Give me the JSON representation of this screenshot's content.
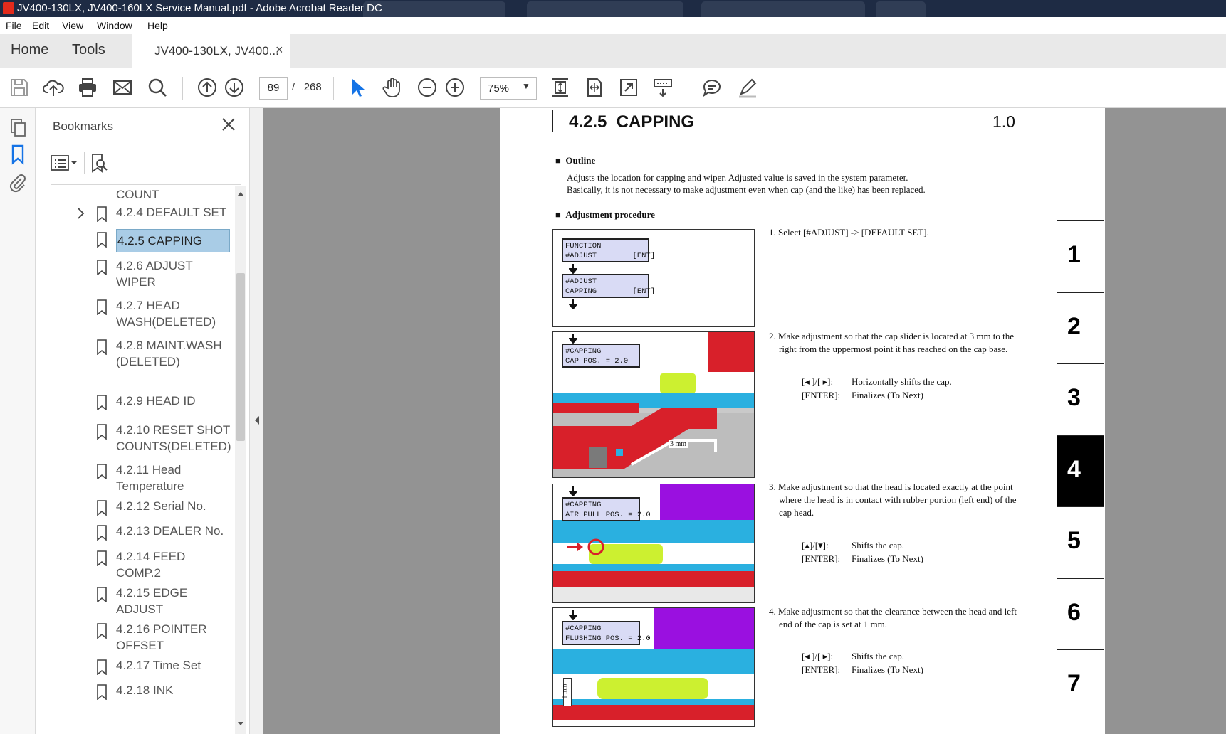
{
  "window": {
    "title": "JV400-130LX, JV400-160LX Service Manual.pdf - Adobe Acrobat Reader DC"
  },
  "menu": [
    "File",
    "Edit",
    "View",
    "Window",
    "Help"
  ],
  "tabs": {
    "home": "Home",
    "tools": "Tools",
    "document": "JV400-130LX, JV400...",
    "close": "×"
  },
  "toolbar": {
    "page_current": "89",
    "page_sep": "/",
    "page_total": "268",
    "zoom": "75%"
  },
  "bookmarks": {
    "header": "Bookmarks",
    "items": [
      {
        "label": "COUNT"
      },
      {
        "label": "4.2.4 DEFAULT SET"
      },
      {
        "label": "4.2.5 CAPPING"
      },
      {
        "label": "4.2.6 ADJUST WIPER"
      },
      {
        "label": "4.2.7 HEAD WASH(DELETED)"
      },
      {
        "label": "4.2.8 MAINT.WASH(DELETED)"
      },
      {
        "label": "4.2.9 HEAD ID"
      },
      {
        "label": "4.2.10 RESET SHOT COUNTS(DELETED)"
      },
      {
        "label": "4.2.11 Head Temperature"
      },
      {
        "label": "4.2.12 Serial No."
      },
      {
        "label": "4.2.13 DEALER No."
      },
      {
        "label": "4.2.14 FEED COMP.2"
      },
      {
        "label": "4.2.15 EDGE ADJUST"
      },
      {
        "label": "4.2.16 POINTER OFFSET"
      },
      {
        "label": "4.2.17 Time Set"
      },
      {
        "label": "4.2.18 INK"
      }
    ]
  },
  "doc": {
    "section_title": "4.2.5  CAPPING",
    "version": "1.0",
    "outline_heading": "Outline",
    "outline_line1": "Adjusts the location for capping and wiper. Adjusted value is saved in the system parameter.",
    "outline_line2": "Basically, it is not necessary to make adjustment even when cap (and the like) has been replaced.",
    "procedure_heading": "Adjustment procedure",
    "lcd1_line1": "FUNCTION",
    "lcd1_line2": "#ADJUST        [ENT]",
    "lcd2_line1": "#ADJUST",
    "lcd2_line2": "CAPPING        [ENT]",
    "lcd3_line1": "#CAPPING",
    "lcd3_line2": "CAP POS. = 2.0",
    "lcd4_line1": "#CAPPING",
    "lcd4_line2": "AIR PULL POS. = 2.0",
    "lcd5_line1": "#CAPPING",
    "lcd5_line2": "FLUSHING POS. = 2.0",
    "label_3mm": "3 mm",
    "label_1mm": "1 mm",
    "step1": "1. Select [#ADJUST] -> [DEFAULT SET].",
    "step2_a": "2. Make adjustment so that the cap slider is located at 3 mm to the",
    "step2_b": "right from the uppermost point it has reached on the cap base.",
    "step2_key1": "[◂ ]/[ ▸]:",
    "step2_key1_desc": "Horizontally shifts the cap.",
    "step2_key2": "[ENTER]:",
    "step2_key2_desc": "Finalizes (To Next)",
    "step3_a": "3. Make adjustment so that the head is located exactly at the point",
    "step3_b": "where the head is in contact with rubber portion (left end) of the",
    "step3_c": "cap head.",
    "step3_key1": "[▴]/[▾]:",
    "step3_key1_desc": "Shifts the cap.",
    "step3_key2": "[ENTER]:",
    "step3_key2_desc": "Finalizes (To Next)",
    "step4_a": "4. Make adjustment so that the clearance between the head and left",
    "step4_b": "end of the cap is set at 1 mm.",
    "step4_key1": "[◂ ]/[ ▸]:",
    "step4_key1_desc": "Shifts the cap.",
    "step4_key2": "[ENTER]:",
    "step4_key2_desc": "Finalizes (To Next)",
    "chapters": [
      "1",
      "2",
      "3",
      "4",
      "5",
      "6",
      "7"
    ],
    "active_chapter": "4"
  },
  "colors": {
    "titlebar": "#1e2b44",
    "accent_blue": "#1473e6",
    "selection": "#a9cce6",
    "viewer_bg": "#939393",
    "fig_red": "#d8202a",
    "fig_cyan": "#2ab0e0",
    "fig_yellow": "#ccf030",
    "fig_purple": "#9a10e0"
  }
}
